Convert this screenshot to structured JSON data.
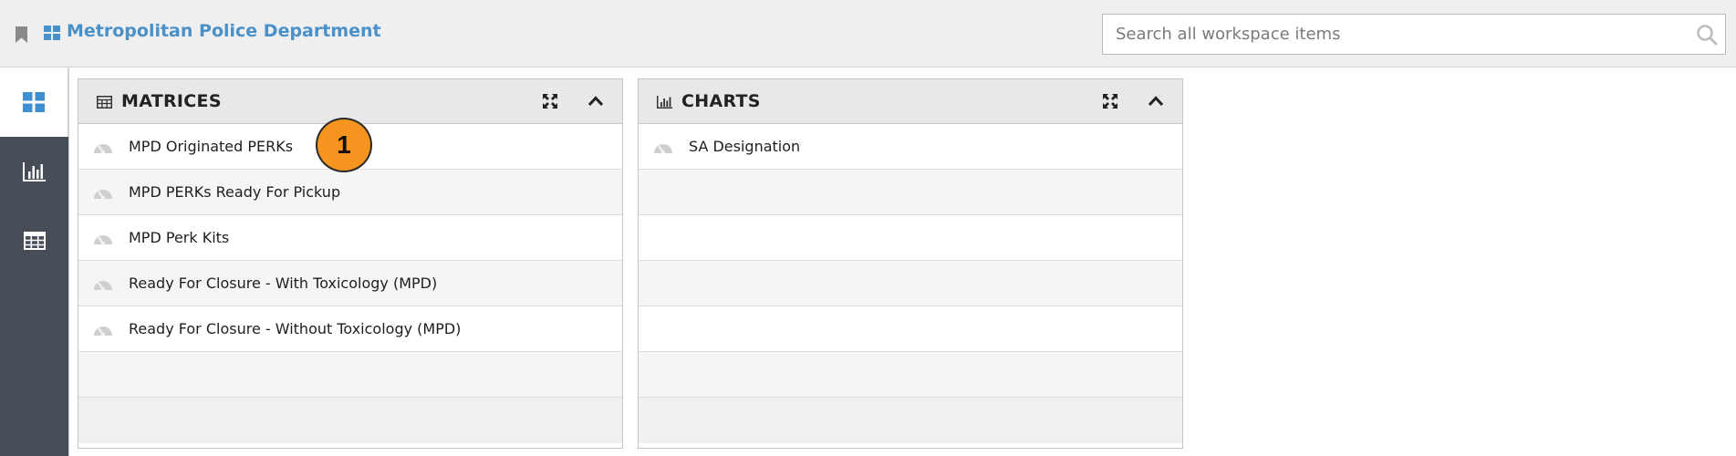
{
  "header": {
    "workspace_title": "Metropolitan Police Department",
    "search_placeholder": "Search all workspace items"
  },
  "rail": {
    "items": [
      {
        "icon": "dashboard-grid-icon",
        "active": true
      },
      {
        "icon": "bar-chart-icon",
        "active": false
      },
      {
        "icon": "table-icon",
        "active": false
      }
    ]
  },
  "panels": {
    "matrices": {
      "title": "MATRICES",
      "icon": "table-icon",
      "items": [
        "MPD Originated PERKs",
        "MPD PERKs Ready For Pickup",
        "MPD Perk Kits",
        "Ready For Closure - With Toxicology (MPD)",
        "Ready For Closure - Without Toxicology (MPD)"
      ]
    },
    "charts": {
      "title": "CHARTS",
      "icon": "bar-chart-icon",
      "items": [
        "SA Designation"
      ]
    }
  },
  "callout": {
    "label": "1"
  },
  "colors": {
    "accent": "#4a90c9",
    "rail": "#474d57",
    "header_bg": "#efefef",
    "callout": "#f5951f"
  }
}
